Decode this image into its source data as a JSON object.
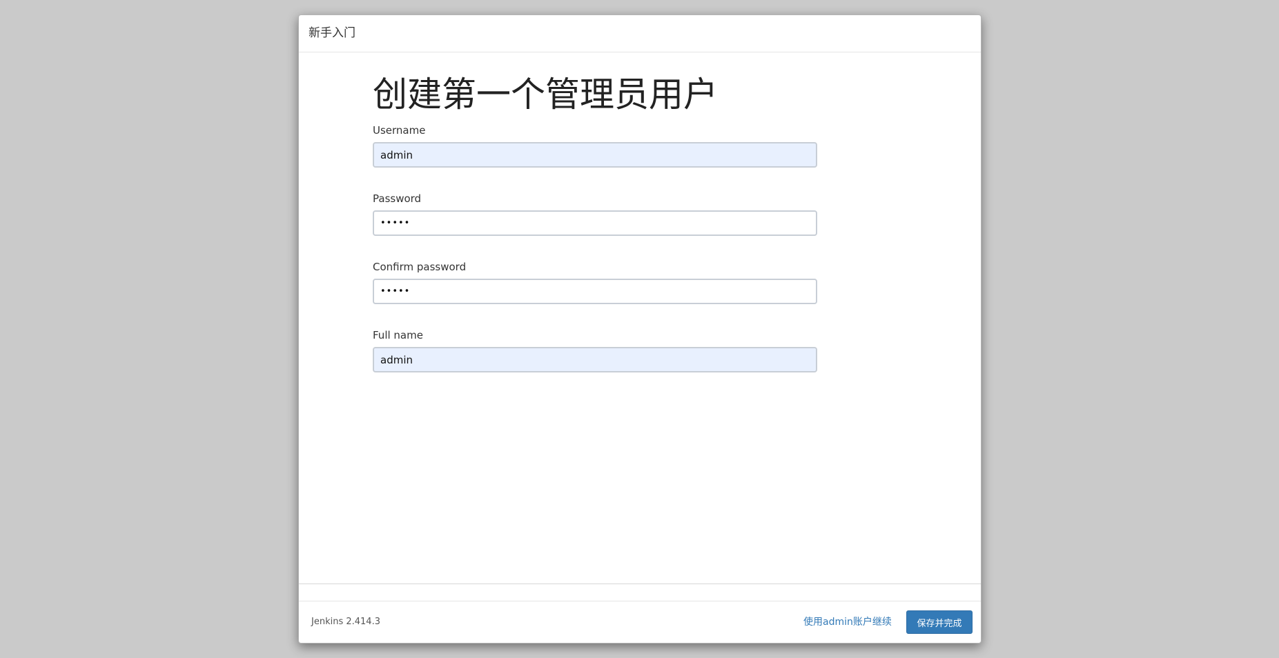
{
  "dialog": {
    "title": "新手入门"
  },
  "form": {
    "heading": "创建第一个管理员用户",
    "fields": [
      {
        "label": "Username",
        "value": "admin",
        "type": "text"
      },
      {
        "label": "Password",
        "value": "•••••",
        "type": "password"
      },
      {
        "label": "Confirm password",
        "value": "•••••",
        "type": "password"
      },
      {
        "label": "Full name",
        "value": "admin",
        "type": "text"
      }
    ]
  },
  "footer": {
    "version": "Jenkins 2.414.3",
    "skip_link": "使用admin账户继续",
    "save_label": "保存并完成"
  },
  "colors": {
    "primary": "#337ab7",
    "autofill": "#e8f0fe",
    "backdrop": "#cacaca"
  }
}
